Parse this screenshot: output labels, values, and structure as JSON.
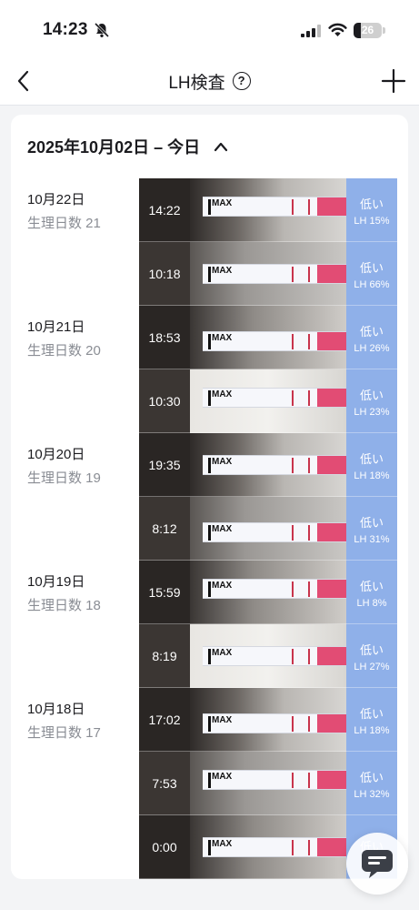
{
  "status_bar": {
    "time": "14:23",
    "battery": "26",
    "battery_level": 0.26
  },
  "nav": {
    "title": "LH検査",
    "help_glyph": "?",
    "icons": {
      "back": "chevron-left-icon",
      "help": "question-circle-icon",
      "add": "plus-icon"
    }
  },
  "card": {
    "header": "2025年10月02日 – 今日",
    "groups": [
      {
        "date": "10月22日",
        "cycle": "生理日数 21",
        "entries": [
          {
            "time": "14:22",
            "level": "低い",
            "lh": "LH 15%"
          },
          {
            "time": "10:18",
            "level": "低い",
            "lh": "LH 66%"
          }
        ]
      },
      {
        "date": "10月21日",
        "cycle": "生理日数 20",
        "entries": [
          {
            "time": "18:53",
            "level": "低い",
            "lh": "LH 26%"
          },
          {
            "time": "10:30",
            "level": "低い",
            "lh": "LH 23%"
          }
        ]
      },
      {
        "date": "10月20日",
        "cycle": "生理日数 19",
        "entries": [
          {
            "time": "19:35",
            "level": "低い",
            "lh": "LH 18%"
          },
          {
            "time": "8:12",
            "level": "低い",
            "lh": "LH 31%"
          }
        ]
      },
      {
        "date": "10月19日",
        "cycle": "生理日数 18",
        "entries": [
          {
            "time": "15:59",
            "level": "低い",
            "lh": "LH 8%"
          },
          {
            "time": "8:19",
            "level": "低い",
            "lh": "LH 27%"
          }
        ]
      },
      {
        "date": "10月18日",
        "cycle": "生理日数 17",
        "entries": [
          {
            "time": "17:02",
            "level": "低い",
            "lh": "LH 18%"
          },
          {
            "time": "7:53",
            "level": "低い",
            "lh": "LH 32%"
          },
          {
            "time": "0:00",
            "level": "低い",
            "lh": ""
          }
        ]
      }
    ]
  },
  "strip_text": "MAX",
  "colors": {
    "result_bg": "#8fb0e9",
    "time_bg": "#3b3633",
    "strip_pink": "#e24c74",
    "test_line": "#c8344c"
  }
}
